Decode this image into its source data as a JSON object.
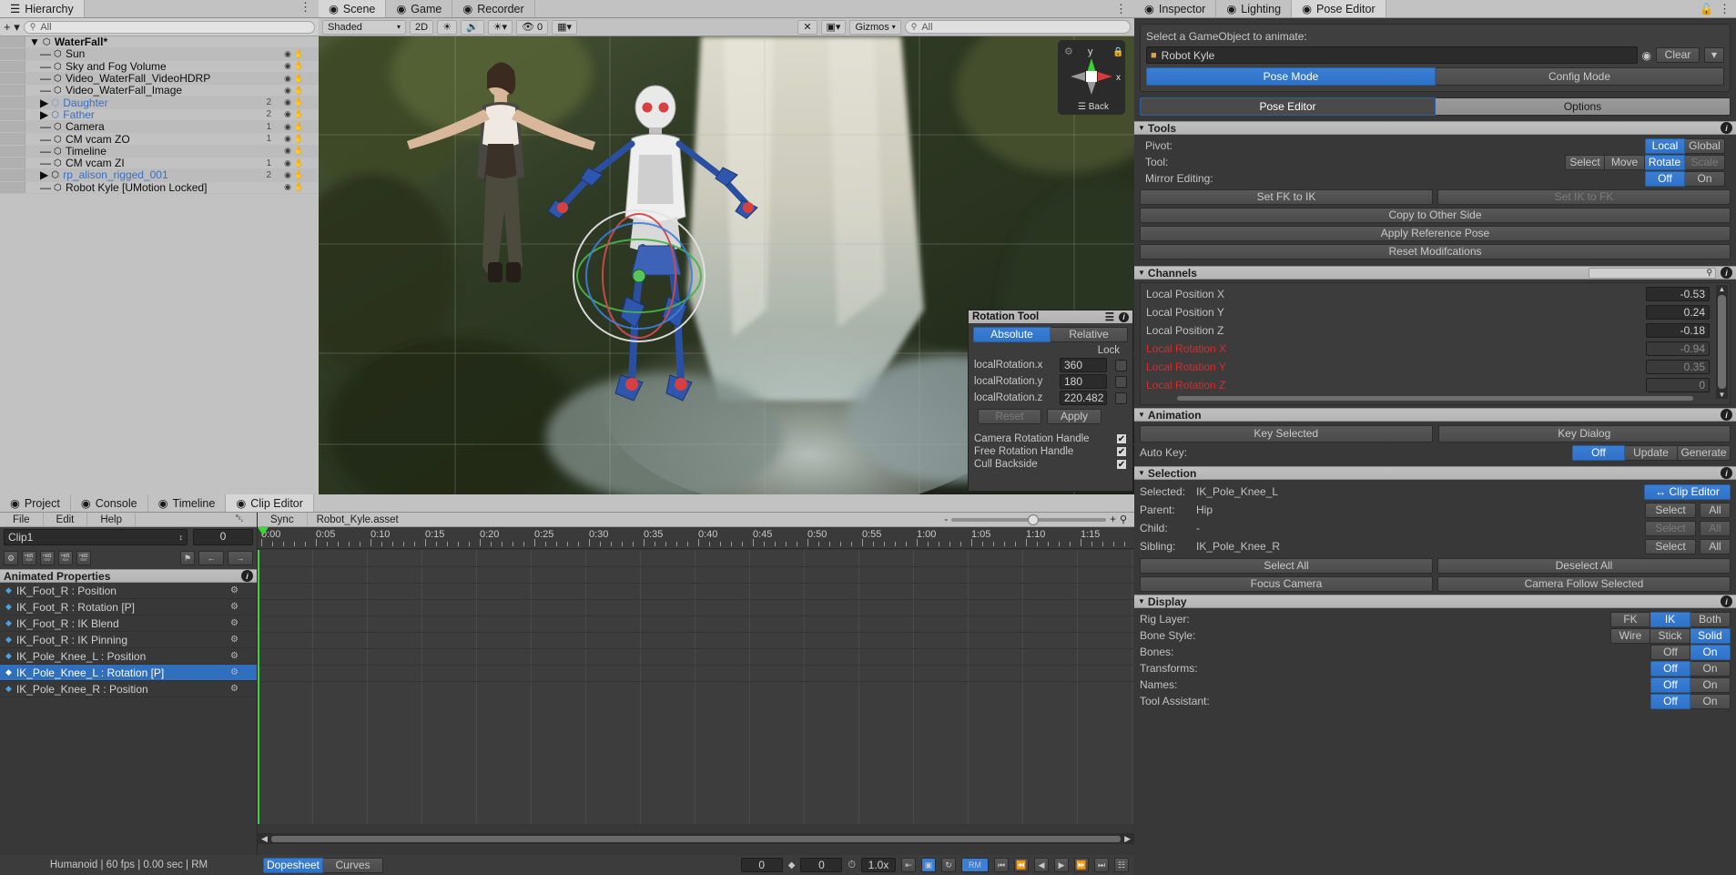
{
  "hierarchy": {
    "tab": "Hierarchy",
    "create_label": "+",
    "search_placeholder": "All",
    "items": [
      {
        "label": "WaterFall*",
        "depth": 0,
        "count": "",
        "type": "scene",
        "bold": true
      },
      {
        "label": "Sun",
        "depth": 1,
        "count": "",
        "type": "go"
      },
      {
        "label": "Sky and Fog Volume",
        "depth": 1,
        "count": "",
        "type": "go"
      },
      {
        "label": "Video_WaterFall_VideoHDRP",
        "depth": 1,
        "count": "",
        "type": "go"
      },
      {
        "label": "Video_WaterFall_Image",
        "depth": 1,
        "count": "",
        "type": "go"
      },
      {
        "label": "Daughter",
        "depth": 1,
        "count": "2",
        "type": "prefab-model"
      },
      {
        "label": "Father",
        "depth": 1,
        "count": "2",
        "type": "prefab-variant"
      },
      {
        "label": "Camera",
        "depth": 1,
        "count": "1",
        "type": "go"
      },
      {
        "label": "CM vcam ZO",
        "depth": 1,
        "count": "1",
        "type": "go"
      },
      {
        "label": "Timeline",
        "depth": 1,
        "count": "",
        "type": "go"
      },
      {
        "label": "CM vcam ZI",
        "depth": 1,
        "count": "1",
        "type": "go"
      },
      {
        "label": "rp_alison_rigged_001",
        "depth": 1,
        "count": "2",
        "type": "prefab"
      },
      {
        "label": "Robot Kyle [UMotion Locked]",
        "depth": 1,
        "count": "",
        "type": "go-orange"
      }
    ]
  },
  "scene": {
    "tabs": [
      {
        "label": "Scene",
        "icon": "scene-icon",
        "active": true
      },
      {
        "label": "Game",
        "icon": "game-icon",
        "active": false
      },
      {
        "label": "Recorder",
        "icon": "recorder-icon",
        "active": false
      }
    ],
    "toolbar": {
      "shading": "Shaded",
      "two_d": "2D",
      "audio_icon": "audio-icon",
      "light_icon": "light-icon",
      "fx_icon": "fx-icon",
      "hidden_count": "0",
      "grid_icon": "grid-icon",
      "gizmos": "Gizmos",
      "search_placeholder": "All"
    },
    "gizmo": {
      "y_label": "y",
      "x_label": "x",
      "view_label": "Back"
    }
  },
  "rotation_tool": {
    "title": "Rotation Tool",
    "modes": [
      {
        "label": "Absolute",
        "active": true
      },
      {
        "label": "Relative",
        "active": false
      }
    ],
    "lock_label": "Lock",
    "axes": [
      {
        "label": "localRotation.x",
        "value": "360",
        "locked": false
      },
      {
        "label": "localRotation.y",
        "value": "180",
        "locked": false
      },
      {
        "label": "localRotation.z",
        "value": "220.482",
        "locked": false
      }
    ],
    "reset_label": "Reset",
    "apply_label": "Apply",
    "toggles": [
      {
        "label": "Camera Rotation Handle",
        "checked": true
      },
      {
        "label": "Free Rotation Handle",
        "checked": true
      },
      {
        "label": "Cull Backside",
        "checked": true
      }
    ]
  },
  "clip_editor": {
    "tabs": [
      {
        "label": "Project",
        "icon": "folder-icon",
        "active": false
      },
      {
        "label": "Console",
        "icon": "console-icon",
        "active": false
      },
      {
        "label": "Timeline",
        "icon": "timeline-icon",
        "active": false
      },
      {
        "label": "Clip Editor",
        "icon": "eye-icon",
        "active": true
      }
    ],
    "menu": [
      "File",
      "Edit",
      "Help"
    ],
    "notify_icon": "bell-icon",
    "sync_label": "Sync",
    "asset_name": "Robot_Kyle.asset",
    "clip_select": "Clip1",
    "frame_value": "0",
    "zoom_minus": "-",
    "zoom_plus": "+",
    "animated_properties_label": "Animated Properties",
    "properties": [
      {
        "label": "IK_Foot_R : Position",
        "selected": false
      },
      {
        "label": "IK_Foot_R : Rotation [P]",
        "selected": false
      },
      {
        "label": "IK_Foot_R : IK Blend",
        "selected": false
      },
      {
        "label": "IK_Foot_R : IK Pinning",
        "selected": false
      },
      {
        "label": "IK_Pole_Knee_L : Position",
        "selected": false
      },
      {
        "label": "IK_Pole_Knee_L : Rotation [P]",
        "selected": true
      },
      {
        "label": "IK_Pole_Knee_R : Position",
        "selected": false
      }
    ],
    "timeline_ticks": [
      "0:00",
      "0:05",
      "0:10",
      "0:15",
      "0:20",
      "0:25",
      "0:30",
      "0:35",
      "0:40",
      "0:45",
      "0:50",
      "0:55",
      "1:00",
      "1:05",
      "1:10",
      "1:15"
    ],
    "status": "Humanoid | 60 fps | 0.00 sec | RM",
    "view_tabs": [
      {
        "label": "Dopesheet",
        "active": true
      },
      {
        "label": "Curves",
        "active": false
      }
    ],
    "playback": {
      "left_value": "0",
      "right_value": "0",
      "speed": "1.0x",
      "rm_label": "RM"
    }
  },
  "inspector": {
    "tabs": [
      {
        "label": "Inspector",
        "icon": "info-icon",
        "active": false
      },
      {
        "label": "Lighting",
        "icon": "bulb-icon",
        "active": false
      },
      {
        "label": "Pose Editor",
        "icon": "eye-icon",
        "active": true
      }
    ],
    "lock_icon": "lock-icon",
    "menu_icon": "kebab-icon",
    "select_prompt": "Select a GameObject to animate:",
    "object_field": "Robot Kyle",
    "clear_label": "Clear",
    "modes": [
      {
        "label": "Pose Mode",
        "active": true
      },
      {
        "label": "Config Mode",
        "active": false
      }
    ],
    "subtabs": [
      {
        "label": "Pose Editor",
        "active": true
      },
      {
        "label": "Options",
        "active": false
      }
    ],
    "tools": {
      "title": "Tools",
      "pivot_label": "Pivot:",
      "pivot_options": [
        {
          "label": "Local",
          "active": true
        },
        {
          "label": "Global",
          "active": false
        }
      ],
      "tool_label": "Tool:",
      "tool_options": [
        {
          "label": "Select",
          "active": false
        },
        {
          "label": "Move",
          "active": false
        },
        {
          "label": "Rotate",
          "active": true
        },
        {
          "label": "Scale",
          "active": false,
          "disabled": true
        }
      ],
      "mirror_label": "Mirror Editing:",
      "mirror_options": [
        {
          "label": "Off",
          "active": true
        },
        {
          "label": "On",
          "active": false
        }
      ],
      "buttons": [
        {
          "label": "Set FK to IK",
          "disabled": false
        },
        {
          "label": "Set IK to FK",
          "disabled": true
        },
        {
          "label": "Copy to Other Side",
          "disabled": false
        },
        {
          "label": "Apply Reference Pose",
          "disabled": false
        },
        {
          "label": "Reset Modifcations",
          "disabled": false
        }
      ]
    },
    "channels": {
      "title": "Channels",
      "search_placeholder": "",
      "rows": [
        {
          "label": "Local Position X",
          "value": "-0.53",
          "red": false,
          "dim": false
        },
        {
          "label": "Local Position Y",
          "value": "0.24",
          "red": false,
          "dim": false
        },
        {
          "label": "Local Position Z",
          "value": "-0.18",
          "red": false,
          "dim": false
        },
        {
          "label": "Local Rotation X",
          "value": "-0.94",
          "red": true,
          "dim": true
        },
        {
          "label": "Local Rotation Y",
          "value": "0.35",
          "red": true,
          "dim": true
        },
        {
          "label": "Local Rotation Z",
          "value": "0",
          "red": true,
          "dim": true
        }
      ]
    },
    "animation": {
      "title": "Animation",
      "key_selected": "Key Selected",
      "key_dialog": "Key Dialog",
      "auto_key_label": "Auto Key:",
      "auto_key_options": [
        {
          "label": "Off",
          "active": true
        },
        {
          "label": "Update",
          "active": false
        },
        {
          "label": "Generate",
          "active": false
        }
      ]
    },
    "selection": {
      "title": "Selection",
      "clip_editor_btn": "Clip Editor",
      "rows": [
        {
          "label": "Selected:",
          "value": "IK_Pole_Knee_L",
          "select": "",
          "all": "",
          "disabled": false
        },
        {
          "label": "Parent:",
          "value": "Hip",
          "select": "Select",
          "all": "All",
          "disabled": false
        },
        {
          "label": "Child:",
          "value": "-",
          "select": "Select",
          "all": "All",
          "disabled": true
        },
        {
          "label": "Sibling:",
          "value": "IK_Pole_Knee_R",
          "select": "Select",
          "all": "All",
          "disabled": false
        }
      ],
      "buttons": [
        {
          "label": "Select All"
        },
        {
          "label": "Deselect All"
        },
        {
          "label": "Focus Camera"
        },
        {
          "label": "Camera Follow Selected"
        }
      ]
    },
    "display": {
      "title": "Display",
      "rows": [
        {
          "label": "Rig Layer:",
          "options": [
            {
              "label": "FK",
              "active": false
            },
            {
              "label": "IK",
              "active": true
            },
            {
              "label": "Both",
              "active": false
            }
          ]
        },
        {
          "label": "Bone Style:",
          "options": [
            {
              "label": "Wire",
              "active": false
            },
            {
              "label": "Stick",
              "active": false
            },
            {
              "label": "Solid",
              "active": true
            }
          ]
        },
        {
          "label": "Bones:",
          "options": [
            {
              "label": "Off",
              "active": false
            },
            {
              "label": "On",
              "active": true
            }
          ]
        },
        {
          "label": "Transforms:",
          "options": [
            {
              "label": "Off",
              "active": true
            },
            {
              "label": "On",
              "active": false
            }
          ]
        },
        {
          "label": "Names:",
          "options": [
            {
              "label": "Off",
              "active": true
            },
            {
              "label": "On",
              "active": false
            }
          ]
        },
        {
          "label": "Tool Assistant:",
          "options": [
            {
              "label": "Off",
              "active": true
            },
            {
              "label": "On",
              "active": false
            }
          ]
        }
      ]
    }
  },
  "colors": {
    "accent_blue": "#3b7fd4",
    "selection_blue": "#2f6fbd",
    "red_channel": "#d82a2a",
    "panel_bg": "#383838",
    "light_chrome": "#c2c2c2"
  }
}
